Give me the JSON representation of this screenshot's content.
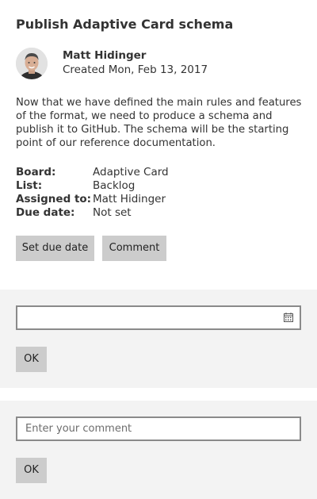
{
  "card": {
    "title": "Publish Adaptive Card schema",
    "author": {
      "name": "Matt Hidinger",
      "created": "Created Mon, Feb 13, 2017",
      "avatar_icon": "person-photo"
    },
    "description": "Now that we have defined the main rules and features of the format, we need to produce a schema and publish it to GitHub. The schema will be the starting point of our reference documentation.",
    "facts": [
      {
        "title": "Board:",
        "value": "Adaptive Card"
      },
      {
        "title": "List:",
        "value": "Backlog"
      },
      {
        "title": "Assigned to:",
        "value": "Matt Hidinger"
      },
      {
        "title": "Due date:",
        "value": "Not set"
      }
    ],
    "actions": {
      "set_due_date": "Set due date",
      "comment": "Comment"
    }
  },
  "due_date_panel": {
    "date_value": "",
    "ok_label": "OK",
    "icon": "calendar-icon"
  },
  "comment_panel": {
    "placeholder": "Enter your comment",
    "ok_label": "OK"
  },
  "colors": {
    "panel_background": "#f3f3f3",
    "button_background": "#cccccc",
    "input_border": "#8a8a8a",
    "text": "#333333"
  }
}
